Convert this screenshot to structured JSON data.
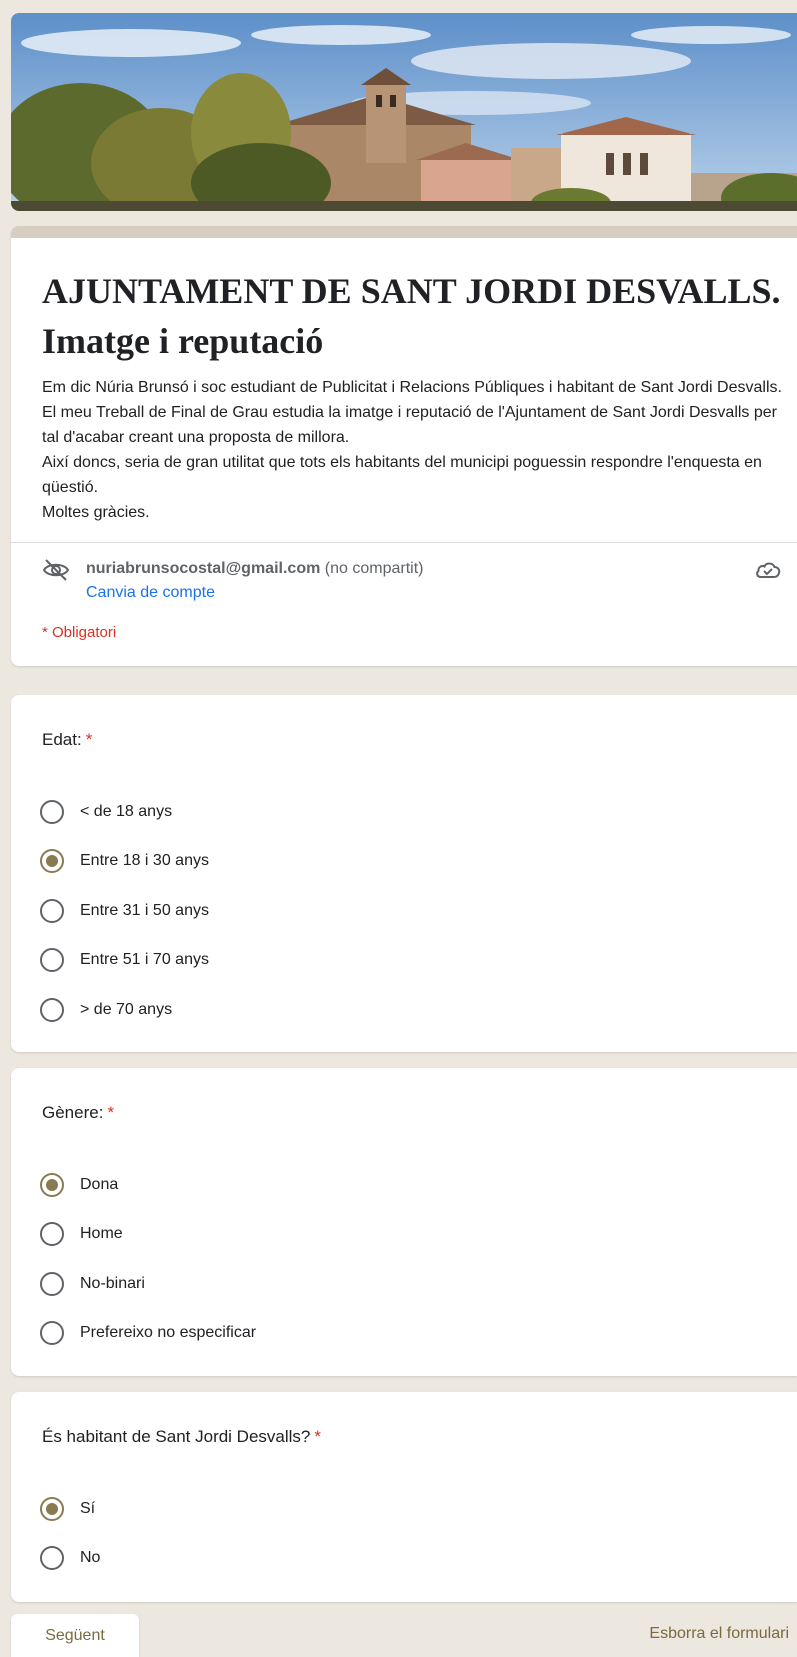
{
  "form": {
    "title": "AJUNTAMENT DE SANT JORDI DESVALLS. Imatge i reputació",
    "description": [
      "Em dic Núria Brunsó i soc estudiant de Publicitat i Relacions Públiques i habitant de Sant Jordi Desvalls. El meu Treball de Final de Grau estudia la imatge i reputació de l'Ajuntament de Sant Jordi Desvalls per tal d'acabar creant una proposta de millora.",
      "Així doncs, seria de gran utilitat que tots els habitants del municipi poguessin respondre l'enquesta en qüestió.",
      "Moltes gràcies."
    ],
    "account_email": "nuriabrunsocostal@gmail.com",
    "account_note": "(no compartit)",
    "switch_account": "Canvia de compte",
    "required_note": "* Obligatori"
  },
  "questions": [
    {
      "title": "Edat:",
      "required_mark": "*",
      "options": [
        "< de 18 anys",
        "Entre 18 i 30 anys",
        "Entre 31 i 50 anys",
        "Entre 51 i 70 anys",
        "> de 70 anys"
      ],
      "selected": 1
    },
    {
      "title": "Gènere:",
      "required_mark": "*",
      "options": [
        "Dona",
        "Home",
        "No-binari",
        "Prefereixo no especificar"
      ],
      "selected": 0
    },
    {
      "title": "És habitant de Sant Jordi Desvalls?",
      "required_mark": "*",
      "options": [
        "Sí",
        "No"
      ],
      "selected": 0
    }
  ],
  "footer": {
    "next_label": "Següent",
    "clear_label": "Esborra el formulari"
  },
  "icons": {
    "hidden": "eye-off-icon",
    "cloud": "cloud-check-icon"
  },
  "colors": {
    "accent": "#8a7a52",
    "link": "#1a73e8",
    "required": "#d93025",
    "background": "#ece7df"
  }
}
